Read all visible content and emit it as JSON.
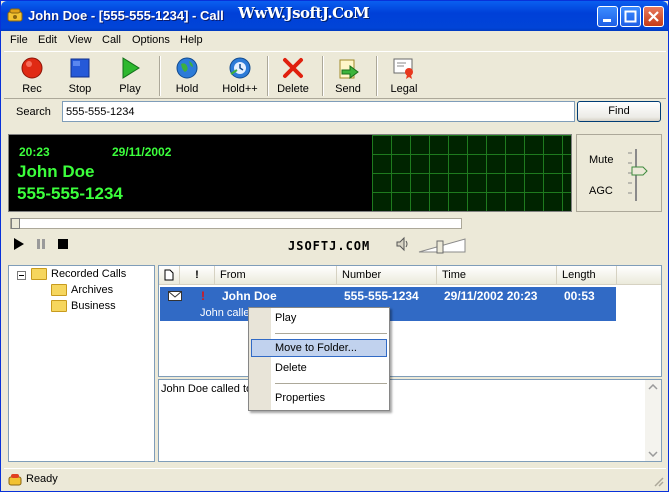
{
  "window": {
    "title": "John Doe - [555-555-1234] - Call",
    "watermark": "WwW.JsoftJ.CoM"
  },
  "menu": [
    "File",
    "Edit",
    "View",
    "Call",
    "Options",
    "Help"
  ],
  "toolbar": [
    {
      "label": "Rec",
      "icon": "record-icon"
    },
    {
      "label": "Stop",
      "icon": "stop-icon"
    },
    {
      "label": "Play",
      "icon": "play-icon"
    },
    {
      "label": "Hold",
      "icon": "hold-globe-icon"
    },
    {
      "label": "Hold++",
      "icon": "hold-plus-icon"
    },
    {
      "label": "Delete",
      "icon": "delete-x-icon"
    },
    {
      "label": "Send",
      "icon": "send-icon"
    },
    {
      "label": "Legal",
      "icon": "legal-certificate-icon"
    }
  ],
  "search": {
    "label": "Search",
    "value": "555-555-1234",
    "button": "Find"
  },
  "display": {
    "time": "20:23",
    "date": "29/11/2002",
    "name": "John Doe",
    "number": "555-555-1234"
  },
  "mixer": {
    "mute": "Mute",
    "agc": "AGC"
  },
  "player": {
    "site": "JSOFTJ.COM",
    "progress": 0
  },
  "tree": {
    "root": "Recorded Calls",
    "children": [
      "Archives",
      "Business"
    ]
  },
  "list": {
    "columns": [
      "From",
      "Number",
      "Time",
      "Length"
    ],
    "rows": [
      {
        "from": "John Doe",
        "number": "555-555-1234",
        "time": "29/11/2002 20:23",
        "length": "00:53",
        "note": "John called"
      }
    ]
  },
  "preview": {
    "text": "John Doe called to rem"
  },
  "context_menu": [
    "Play",
    "Move to Folder...",
    "Delete",
    "Properties"
  ],
  "status": {
    "text": "Ready"
  },
  "colors": {
    "titlebar": "#0A5FF0",
    "lcd_text": "#3CFF3C",
    "selection": "#316AC5"
  }
}
